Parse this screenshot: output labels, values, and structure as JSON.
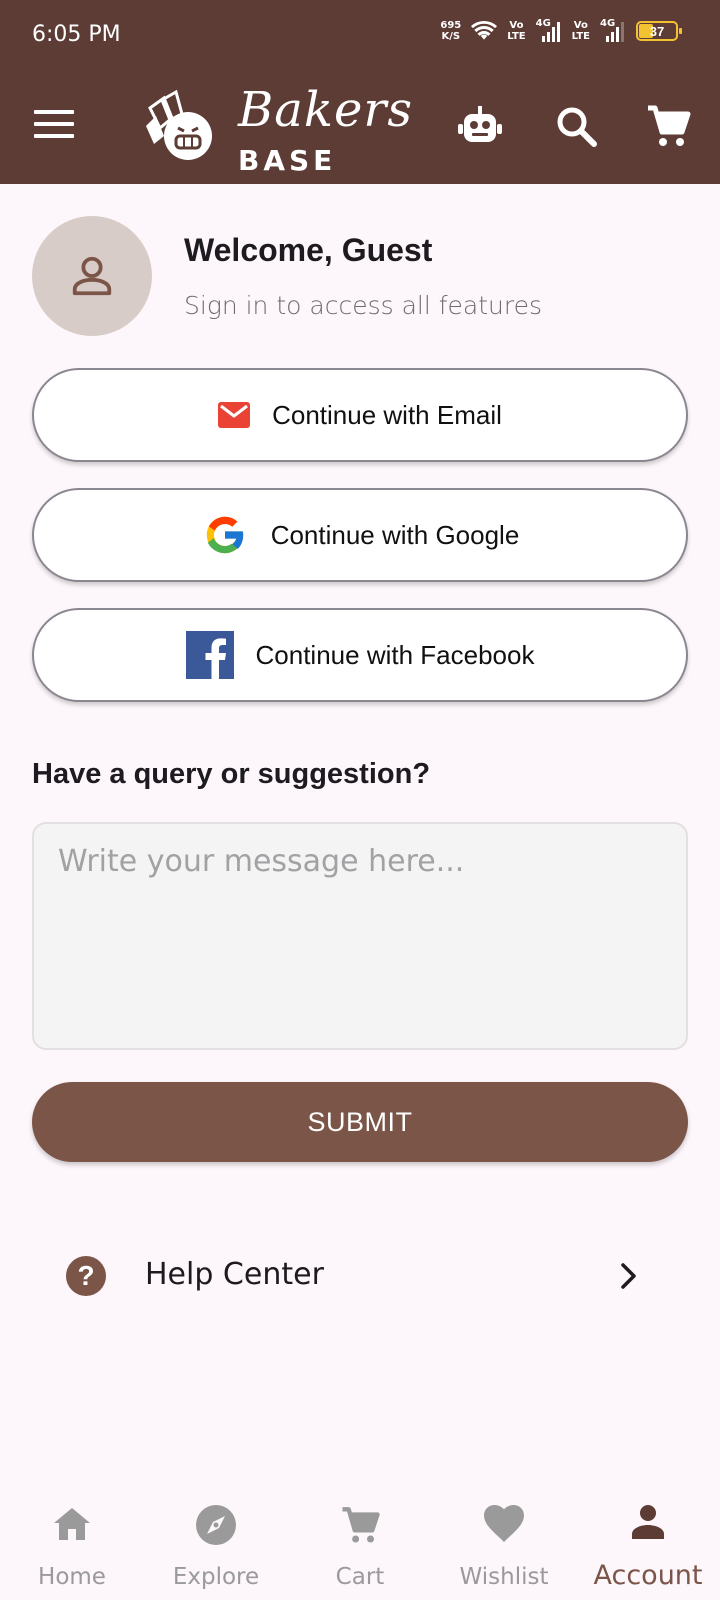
{
  "status_bar": {
    "time": "6:05 PM",
    "net_speed_value": "695",
    "net_speed_unit": "K/S",
    "sim1_label_top": "Vo",
    "sim1_label_bottom": "LTE",
    "sim1_net": "4G",
    "sim2_label_top": "Vo",
    "sim2_label_bottom": "LTE",
    "sim2_net": "4G",
    "battery": "37"
  },
  "app_bar": {
    "logo_script": "Bakers",
    "logo_sub": "BASE",
    "icons": [
      "menu-icon",
      "robot-icon",
      "search-icon",
      "cart-icon"
    ]
  },
  "welcome": {
    "title": "Welcome, Guest",
    "subtitle": "Sign in to access all features"
  },
  "signin": {
    "email_label": "Continue with Email",
    "google_label": "Continue with Google",
    "facebook_label": "Continue with Facebook"
  },
  "feedback": {
    "title": "Have a query or suggestion?",
    "placeholder": "Write your message here...",
    "submit_label": "SUBMIT"
  },
  "help": {
    "label": "Help Center"
  },
  "bottom_nav": {
    "items": [
      {
        "label": "Home",
        "icon": "home-icon"
      },
      {
        "label": "Explore",
        "icon": "compass-icon"
      },
      {
        "label": "Cart",
        "icon": "cart-icon"
      },
      {
        "label": "Wishlist",
        "icon": "heart-icon"
      },
      {
        "label": "Account",
        "icon": "person-icon"
      }
    ],
    "active": "Account"
  },
  "colors": {
    "brand_dark": "#5c3c35",
    "brand_accent": "#7b5548",
    "background": "#fdf6fb"
  }
}
